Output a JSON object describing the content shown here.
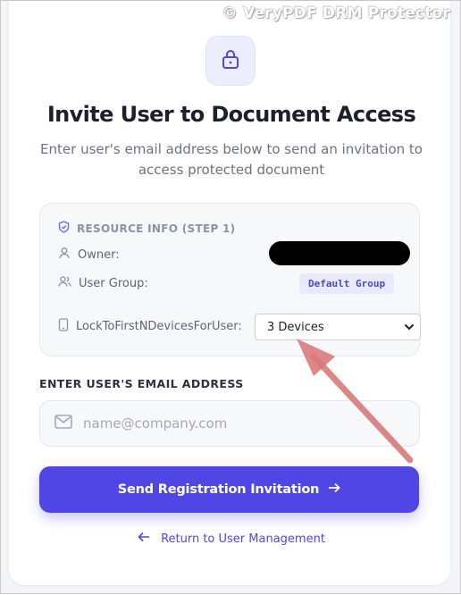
{
  "watermark": "© VeryPDF DRM Protector",
  "header": {
    "title": "Invite User to Document Access",
    "subtitle": "Enter user's email address below to send an invitation to access protected document"
  },
  "resource_info": {
    "heading": "RESOURCE INFO (STEP 1)",
    "owner_label": "Owner:",
    "user_group_label": "User Group:",
    "user_group_value": "Default Group",
    "device_limit_label": "LockToFirstNDevicesForUser:",
    "device_limit_selected": "3 Devices"
  },
  "email": {
    "label": "ENTER USER'S EMAIL ADDRESS",
    "value": "",
    "placeholder": "name@company.com"
  },
  "actions": {
    "submit_label": "Send Registration Invitation",
    "back_label": "Return to User Management"
  },
  "colors": {
    "accent": "#4f46e5",
    "annotation_arrow": "#d97a7a"
  },
  "icons": [
    "lock-icon",
    "shield-icon",
    "user-icon",
    "users-icon",
    "device-icon",
    "mail-icon",
    "arrow-right-icon",
    "arrow-left-icon"
  ]
}
